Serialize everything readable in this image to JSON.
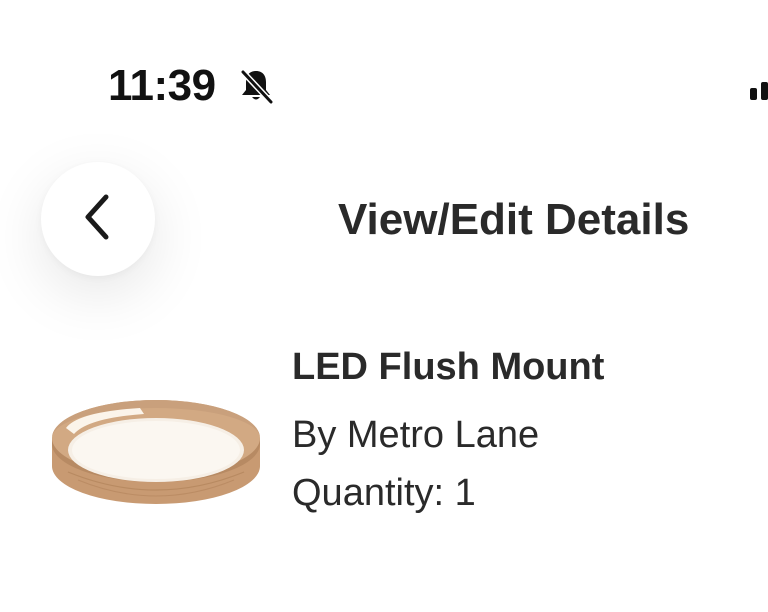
{
  "status_bar": {
    "time": "11:39",
    "icons": [
      "bell-slash-icon",
      "cellular-signal-icon"
    ]
  },
  "header": {
    "back_icon": "chevron-left-icon",
    "title": "View/Edit Details"
  },
  "product": {
    "image_icon": "led-flush-mount-ceiling-light",
    "name": "LED Flush Mount",
    "brand": "By Metro Lane",
    "quantity": "Quantity: 1"
  },
  "colors": {
    "text": "#2a2a2a",
    "background": "#ffffff",
    "wood": "#c9a07c"
  }
}
